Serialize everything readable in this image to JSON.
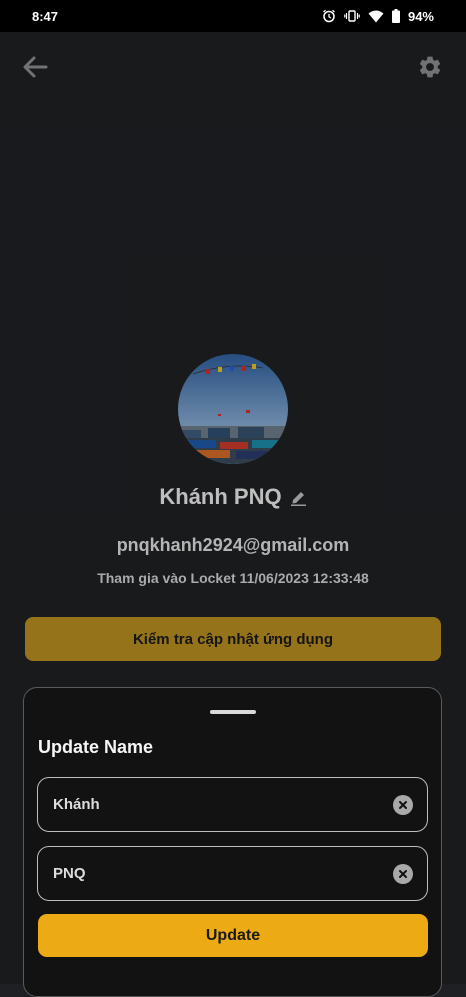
{
  "status_bar": {
    "time": "8:47",
    "battery": "94%"
  },
  "profile": {
    "name": "Khánh PNQ",
    "email": "pnqkhanh2924@gmail.com",
    "joined": "Tham gia vào Locket 11/06/2023 12:33:48"
  },
  "check_update_label": "Kiểm tra cập nhật ứng dụng",
  "sheet": {
    "title": "Update Name",
    "first_name_value": "Khánh",
    "last_name_value": "PNQ",
    "update_label": "Update"
  },
  "icons": {
    "back": "arrow-left-icon",
    "settings": "gear-icon",
    "edit": "pencil-icon",
    "clear": "close-circle-icon"
  },
  "colors": {
    "background": "#1e2023",
    "check_update_button": "#b68d20",
    "update_button": "#ecab14",
    "sheet_background": "#121212"
  }
}
